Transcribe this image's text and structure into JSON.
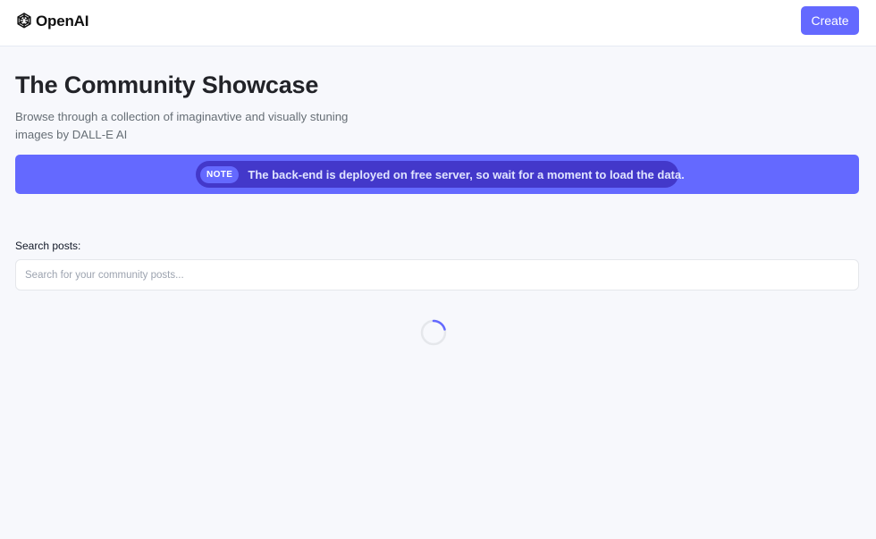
{
  "header": {
    "logo_text": "OpenAI",
    "create_label": "Create"
  },
  "main": {
    "title": "The Community Showcase",
    "subtitle": "Browse through a collection of imaginavtive and visually stuning images by DALL-E AI"
  },
  "note": {
    "tag": "NOTE",
    "text": "The back-end is deployed on free server, so wait for a moment to load the data."
  },
  "search": {
    "label": "Search posts:",
    "placeholder": "Search for your community posts...",
    "value": ""
  },
  "colors": {
    "accent": "#6469ff",
    "note_pill": "#4338ca",
    "background": "#f7f8fc"
  },
  "icons": {
    "logo": "openai-logo-icon",
    "loading": "loading-spinner-icon"
  }
}
